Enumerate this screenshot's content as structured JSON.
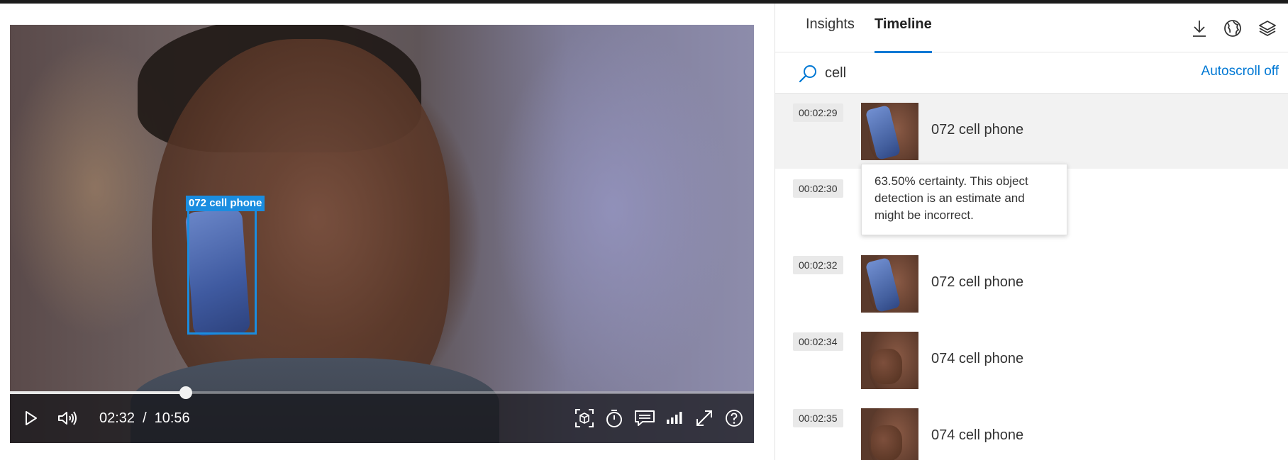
{
  "video": {
    "detection_label": "072 cell phone",
    "current_time": "02:32",
    "time_separator": "/",
    "duration": "10:56",
    "progress_fraction": 0.2363,
    "controls": [
      "play-icon",
      "volume-icon",
      "object-detection-icon",
      "timer-icon",
      "captions-icon",
      "quality-icon",
      "fullscreen-icon",
      "help-icon"
    ]
  },
  "panel": {
    "tabs": [
      {
        "label": "Insights",
        "active": false
      },
      {
        "label": "Timeline",
        "active": true
      }
    ],
    "toolbar_icons": [
      "download-icon",
      "globe-icon",
      "layers-icon"
    ],
    "search": {
      "value": "cell",
      "placeholder": ""
    },
    "autoscroll_label": "Autoscroll off",
    "accent_color": "#0078d4",
    "rows": [
      {
        "timestamp": "00:02:29",
        "label": "072 cell phone",
        "selected": true
      },
      {
        "timestamp": "00:02:30",
        "label": "",
        "selected": false
      },
      {
        "timestamp": "00:02:32",
        "label": "072 cell phone",
        "selected": false
      },
      {
        "timestamp": "00:02:34",
        "label": "074 cell phone",
        "selected": false
      },
      {
        "timestamp": "00:02:35",
        "label": "074 cell phone",
        "selected": false
      }
    ],
    "tooltip": "63.50% certainty. This object detection is an estimate and might be incorrect."
  }
}
